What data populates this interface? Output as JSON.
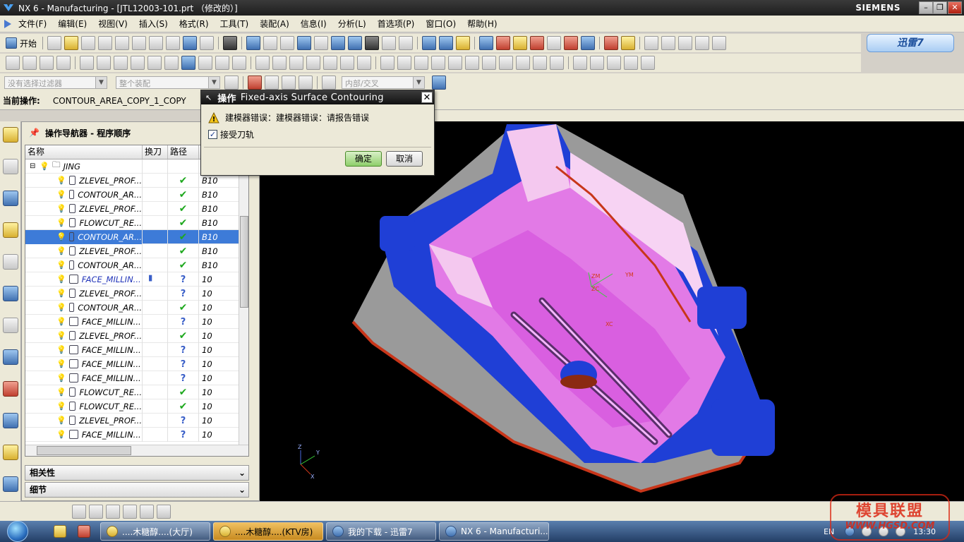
{
  "window": {
    "title": "NX 6 - Manufacturing - [JTL12003-101.prt （修改的）]",
    "brand": "SIEMENS"
  },
  "menu": [
    "文件(F)",
    "编辑(E)",
    "视图(V)",
    "插入(S)",
    "格式(R)",
    "工具(T)",
    "装配(A)",
    "信息(I)",
    "分析(L)",
    "首选项(P)",
    "窗口(O)",
    "帮助(H)"
  ],
  "toolbar": {
    "start_label": "开始"
  },
  "xunlei": {
    "label": "迅雷7"
  },
  "filters": {
    "selection_filter": "没有选择过滤器",
    "assembly_scope": "整个装配",
    "inner_intersect": "内部/交叉"
  },
  "current_op": {
    "label": "当前操作:",
    "value": "CONTOUR_AREA_COPY_1_COPY"
  },
  "navigator": {
    "title": "操作导航器 - 程序顺序",
    "columns": [
      "名称",
      "换刀",
      "路径"
    ],
    "root": "JING",
    "rows": [
      {
        "name": "ZLEVEL_PROF...",
        "path": "tick",
        "extra": "B10"
      },
      {
        "name": "CONTOUR_AR...",
        "path": "tick",
        "extra": "B10"
      },
      {
        "name": "ZLEVEL_PROF...",
        "path": "tick",
        "extra": "B10"
      },
      {
        "name": "FLOWCUT_RE...",
        "path": "tick",
        "extra": "B10"
      },
      {
        "name": "CONTOUR_AR...",
        "path": "tick",
        "extra": "B10",
        "selected": true
      },
      {
        "name": "ZLEVEL_PROF...",
        "path": "tick",
        "extra": "B10"
      },
      {
        "name": "CONTOUR_AR...",
        "path": "tick",
        "extra": "B10"
      },
      {
        "name": "FACE_MILLIN...",
        "path": "query",
        "extra": "10",
        "blue": true,
        "tool": true
      },
      {
        "name": "ZLEVEL_PROF...",
        "path": "query",
        "extra": "10"
      },
      {
        "name": "CONTOUR_AR...",
        "path": "tick",
        "extra": "10"
      },
      {
        "name": "FACE_MILLIN...",
        "path": "query",
        "extra": "10"
      },
      {
        "name": "ZLEVEL_PROF...",
        "path": "tick",
        "extra": "10"
      },
      {
        "name": "FACE_MILLIN...",
        "path": "query",
        "extra": "10"
      },
      {
        "name": "FACE_MILLIN...",
        "path": "query",
        "extra": "10"
      },
      {
        "name": "FACE_MILLIN...",
        "path": "query",
        "extra": "10"
      },
      {
        "name": "FLOWCUT_RE...",
        "path": "tick",
        "extra": "10"
      },
      {
        "name": "FLOWCUT_RE...",
        "path": "tick",
        "extra": "10"
      },
      {
        "name": "ZLEVEL_PROF...",
        "path": "query",
        "extra": "10"
      },
      {
        "name": "FACE_MILLIN...",
        "path": "query",
        "extra": "10"
      }
    ],
    "related": "相关性",
    "details": "细节"
  },
  "dialog": {
    "title_prefix": "操作",
    "title": "Fixed-axis Surface Contouring",
    "message": "建模器错误：建模器错误：请报告错误",
    "checkbox": "接受刀轨",
    "ok": "确定",
    "cancel": "取消"
  },
  "axes": {
    "zm": "ZM",
    "ym": "YM",
    "xc": "XC",
    "zc": "ZC",
    "x": "X",
    "y": "Y",
    "z": "Z"
  },
  "taskbar": {
    "tasks": [
      "....木糖醇....(大厅)",
      "....木糖醇....(KTV房)",
      "我的下载 - 迅雷7",
      "NX 6 - Manufacturi..."
    ],
    "lang": "EN",
    "clock": "13:30"
  },
  "watermark": {
    "line1": "模具联盟",
    "line2": "WWW.HGSD.COM"
  },
  "colors": {
    "accent": "#3d7bd8",
    "model_pink": "#e27ae6",
    "model_blue": "#1f3fd6",
    "model_grey": "#9a9a9a"
  }
}
